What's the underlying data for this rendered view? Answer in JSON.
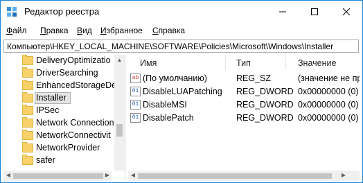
{
  "window": {
    "title": "Редактор реестра",
    "controls": {
      "minimize": "—",
      "maximize": "☐",
      "close": "✕"
    }
  },
  "menu": [
    {
      "pre": "",
      "u": "Ф",
      "post": "айл"
    },
    {
      "pre": "",
      "u": "П",
      "post": "равка"
    },
    {
      "pre": "",
      "u": "В",
      "post": "ид"
    },
    {
      "pre": "",
      "u": "И",
      "post": "збранное"
    },
    {
      "pre": "",
      "u": "С",
      "post": "правка"
    }
  ],
  "address": "Компьютер\\HKEY_LOCAL_MACHINE\\SOFTWARE\\Policies\\Microsoft\\Windows\\Installer",
  "tree": {
    "items": [
      "DeliveryOptimizatio",
      "DriverSearching",
      "EnhancedStorageDe",
      "Installer",
      "IPSec",
      "Network Connection",
      "NetworkConnectivit",
      "NetworkProvider",
      "safer"
    ],
    "selected": "Installer"
  },
  "list": {
    "columns": {
      "name": "Имя",
      "type": "Тип",
      "value": "Значение"
    },
    "rows": [
      {
        "icon": "ab",
        "name": "(По умолчанию)",
        "type": "REG_SZ",
        "value": "(значение не пр"
      },
      {
        "icon": "01",
        "name": "DisableLUAPatching",
        "type": "REG_DWORD",
        "value": "0x00000000 (0)"
      },
      {
        "icon": "01",
        "name": "DisableMSI",
        "type": "REG_DWORD",
        "value": "0x00000000 (0)"
      },
      {
        "icon": "01",
        "name": "DisablePatch",
        "type": "REG_DWORD",
        "value": "0x00000000 (0)"
      }
    ]
  },
  "icons": {
    "app": "regedit-icon",
    "string_value": "reg-sz-icon",
    "dword_value": "reg-dword-icon",
    "folder": "folder-icon"
  },
  "colors": {
    "window_border": "#1883d7",
    "folder": "#f7d26a",
    "selection": "#e5e5e5"
  }
}
